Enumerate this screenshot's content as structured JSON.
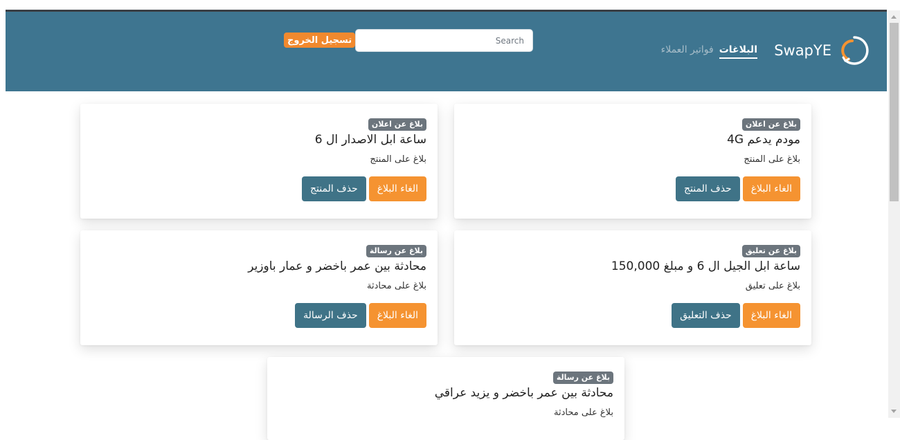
{
  "navbar": {
    "brand": "SwapYE",
    "links": [
      {
        "label": "البلاغات",
        "active": true
      },
      {
        "label": "فواتير العملاء",
        "active": false
      }
    ],
    "search_placeholder": "Search",
    "logout_label": "تسجيل الخروج"
  },
  "cards": [
    {
      "badge": "بلاغ عن اعلان",
      "title": "مودم يدعم 4G",
      "description": "بلاغ على المنتج",
      "cancel_label": "الغاء البلاغ",
      "delete_label": "حذف المنتج"
    },
    {
      "badge": "بلاغ عن اعلان",
      "title": "ساعة ابل الاصدار ال 6",
      "description": "بلاغ على المنتج",
      "cancel_label": "الغاء البلاغ",
      "delete_label": "حذف المنتج"
    },
    {
      "badge": "بلاغ عن تعليق",
      "title": "ساعة ابل الجيل ال 6 و مبلغ 150,000",
      "description": "بلاغ على تعليق",
      "cancel_label": "الغاء البلاغ",
      "delete_label": "حذف التعليق"
    },
    {
      "badge": "بلاغ عن رسالة",
      "title": "محادثة بين عمر باخضر و عمار باوزير",
      "description": "بلاغ على محادثة",
      "cancel_label": "الغاء البلاغ",
      "delete_label": "حذف الرسالة"
    },
    {
      "badge": "بلاغ عن رسالة",
      "title": "محادثة بين عمر باخضر و يزيد عراقي",
      "description": "بلاغ على محادثة"
    }
  ],
  "colors": {
    "navbar": "#3e7590",
    "accent_orange": "#f59331",
    "button_teal": "#3f7387",
    "badge_gray": "#6c757d"
  }
}
